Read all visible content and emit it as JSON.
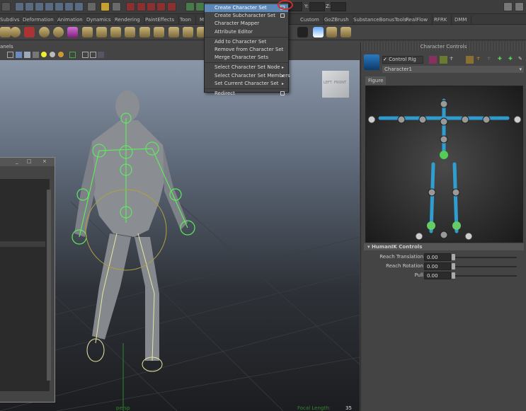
{
  "status_line": {
    "coord_labels": [
      "Y:",
      "Z:"
    ]
  },
  "shelf_tabs": [
    "Subdivs",
    "Deformation",
    "Animation",
    "Dynamics",
    "Rendering",
    "PaintEffects",
    "Toon",
    "Mu",
    "Custom",
    "GoZBrush",
    "SubstanceBonusTools",
    "RealFlow",
    "RFRK",
    "DMM"
  ],
  "panel_menu": {
    "label": "anels"
  },
  "context_menu": {
    "items": [
      {
        "label": "Create Character Set",
        "option_box": true,
        "highlighted": true
      },
      {
        "label": "Create Subcharacter Set",
        "option_box": true
      },
      {
        "label": "Character Mapper"
      },
      {
        "label": "Attribute Editor",
        "sep_after": true
      },
      {
        "label": "Add to Character Set"
      },
      {
        "label": "Remove from Character Set"
      },
      {
        "label": "Merge Character Sets",
        "sep_after": true
      },
      {
        "label": "Select Character Set Node",
        "submenu": true
      },
      {
        "label": "Select Character Set Members",
        "submenu": true
      },
      {
        "label": "Set Current Character Set",
        "submenu": true,
        "sep_after": true
      },
      {
        "label": "Redirect",
        "option_box": true
      }
    ]
  },
  "character_controls": {
    "title": "Character Controls",
    "control_rig_label": "Control Rig",
    "control_rig_checked": true,
    "character": "Character1",
    "tab": "Figure",
    "humanik_section": "HumanIK Controls",
    "fields": [
      {
        "label": "Reach Translation",
        "value": "0.00"
      },
      {
        "label": "Reach Rotation",
        "value": "0.00"
      },
      {
        "label": "Pull",
        "value": "0.00"
      }
    ]
  },
  "viewport": {
    "viewcube": {
      "left": "LEFT",
      "front": "FRONT"
    },
    "camera": "persp",
    "focal_label": "Focal Length:",
    "focal_value": "35"
  },
  "colors": {
    "highlight": "#5b88b8",
    "rig_green": "#4fe04f",
    "hik_blue": "#2fa8e0"
  }
}
